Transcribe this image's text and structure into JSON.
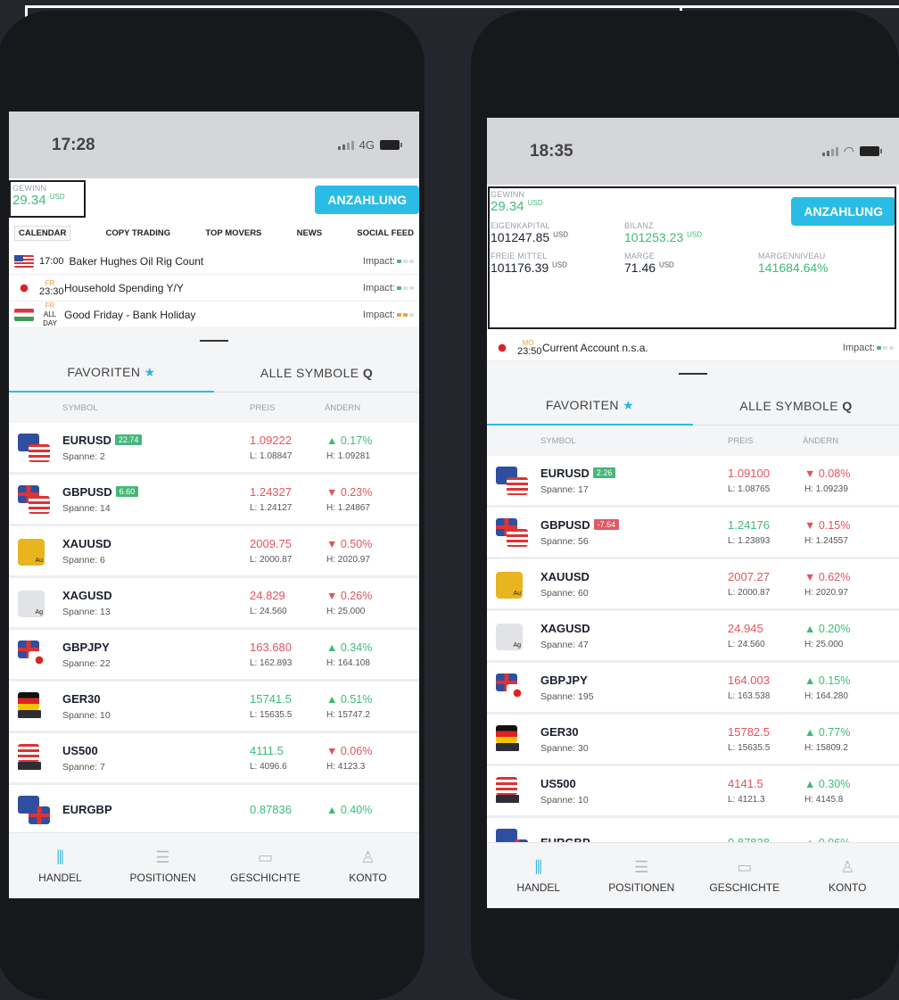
{
  "left": {
    "status": {
      "time": "17:28",
      "network": "4G"
    },
    "account": {
      "gewinn_label": "GEWINN",
      "gewinn_value": "29.34",
      "currency": "USD",
      "deposit_label": "ANZAHLUNG"
    },
    "top_tabs": [
      "CALENDAR",
      "COPY TRADING",
      "TOP MOVERS",
      "NEWS",
      "SOCIAL FEED"
    ],
    "events": [
      {
        "day": "",
        "time": "17:00",
        "name": "Baker Hughes Oil Rig Count",
        "impact_label": "Impact:"
      },
      {
        "day": "FR",
        "time": "23:30",
        "name": "Household Spending Y/Y",
        "impact_label": "Impact:"
      },
      {
        "day": "FR",
        "time": "ALL DAY",
        "name": "Good Friday - Bank Holiday",
        "impact_label": "Impact:"
      }
    ],
    "symtabs": {
      "favorites": "FAVORITEN",
      "all": "ALLE SYMBOLE"
    },
    "columns": {
      "symbol": "SYMBOL",
      "price": "PREIS",
      "change": "ÄNDERN"
    },
    "rows": [
      {
        "symbol": "EURUSD",
        "badge": "22.74",
        "spread": "Spanne: 2",
        "price": "1.09222",
        "low": "L: 1.08847",
        "high": "H: 1.09281",
        "change": "0.17%"
      },
      {
        "symbol": "GBPUSD",
        "badge": "6.60",
        "spread": "Spanne: 14",
        "price": "1.24327",
        "low": "L: 1.24127",
        "high": "H: 1.24867",
        "change": "0.23%"
      },
      {
        "symbol": "XAUUSD",
        "spread": "Spanne: 6",
        "price": "2009.75",
        "low": "L: 2000.87",
        "high": "H: 2020.97",
        "change": "0.50%"
      },
      {
        "symbol": "XAGUSD",
        "spread": "Spanne: 13",
        "price": "24.829",
        "low": "L: 24.560",
        "high": "H: 25.000",
        "change": "0.26%"
      },
      {
        "symbol": "GBPJPY",
        "spread": "Spanne: 22",
        "price": "163.680",
        "low": "L: 162.893",
        "high": "H: 164.108",
        "change": "0.34%"
      },
      {
        "symbol": "GER30",
        "spread": "Spanne: 10",
        "price": "15741.5",
        "low": "L: 15635.5",
        "high": "H: 15747.2",
        "change": "0.51%"
      },
      {
        "symbol": "US500",
        "spread": "Spanne: 7",
        "price": "4111.5",
        "low": "L: 4096.6",
        "high": "H: 4123.3",
        "change": "0.06%"
      },
      {
        "symbol": "EURGBP",
        "price": "0.87836",
        "change": "0.40%"
      }
    ],
    "nav": [
      "HANDEL",
      "POSITIONEN",
      "GESCHICHTE",
      "KONTO"
    ]
  },
  "right": {
    "status": {
      "time": "18:35"
    },
    "account": {
      "gewinn_label": "GEWINN",
      "gewinn_value": "29.34",
      "currency": "USD",
      "deposit_label": "ANZAHLUNG",
      "eigenkapital_label": "EIGENKAPITAL",
      "eigenkapital_value": "101247.85",
      "bilanz_label": "BILANZ",
      "bilanz_value": "101253.23",
      "freie_label": "FREIE MITTEL",
      "freie_value": "101176.39",
      "marge_label": "MARGE",
      "marge_value": "71.46",
      "margenniveau_label": "MARGENNIVEAU",
      "margenniveau_value": "141684.64%"
    },
    "events": [
      {
        "day": "MO",
        "time": "23:50",
        "name": "Current Account n.s.a.",
        "impact_label": "Impact:"
      }
    ],
    "symtabs": {
      "favorites": "FAVORITEN",
      "all": "ALLE SYMBOLE"
    },
    "columns": {
      "symbol": "SYMBOL",
      "price": "PREIS",
      "change": "ÄNDERN"
    },
    "rows": [
      {
        "symbol": "EURUSD",
        "badge": "2.26",
        "spread": "Spanne: 17",
        "price": "1.09100",
        "low": "L: 1.08765",
        "high": "H: 1.09239",
        "change": "0.08%"
      },
      {
        "symbol": "GBPUSD",
        "badge": "-7.64",
        "spread": "Spanne: 56",
        "price": "1.24176",
        "low": "L: 1.23893",
        "high": "H: 1.24557",
        "change": "0.15%"
      },
      {
        "symbol": "XAUUSD",
        "spread": "Spanne: 60",
        "price": "2007.27",
        "low": "L: 2000.87",
        "high": "H: 2020.97",
        "change": "0.62%"
      },
      {
        "symbol": "XAGUSD",
        "spread": "Spanne: 47",
        "price": "24.945",
        "low": "L: 24.560",
        "high": "H: 25.000",
        "change": "0.20%"
      },
      {
        "symbol": "GBPJPY",
        "spread": "Spanne: 195",
        "price": "164.003",
        "low": "L: 163.538",
        "high": "H: 164.280",
        "change": "0.15%"
      },
      {
        "symbol": "GER30",
        "spread": "Spanne: 30",
        "price": "15782.5",
        "low": "L: 15635.5",
        "high": "H: 15809.2",
        "change": "0.77%"
      },
      {
        "symbol": "US500",
        "spread": "Spanne: 10",
        "price": "4141.5",
        "low": "L: 4121.3",
        "high": "H: 4145.8",
        "change": "0.30%"
      },
      {
        "symbol": "EURGBP",
        "price": "0.87838",
        "change": "0.06%"
      }
    ],
    "nav": [
      "HANDEL",
      "POSITIONEN",
      "GESCHICHTE",
      "KONTO"
    ]
  },
  "icons": {
    "up": "▲",
    "down": "▼",
    "star": "★",
    "search": "Q",
    "handel": "candlestick-icon",
    "positionen": "list-icon",
    "geschichte": "calendar-icon",
    "konto": "user-icon"
  },
  "colors": {
    "accent": "#2bbce6",
    "positive": "#3dbb78",
    "negative": "#e2535d"
  }
}
